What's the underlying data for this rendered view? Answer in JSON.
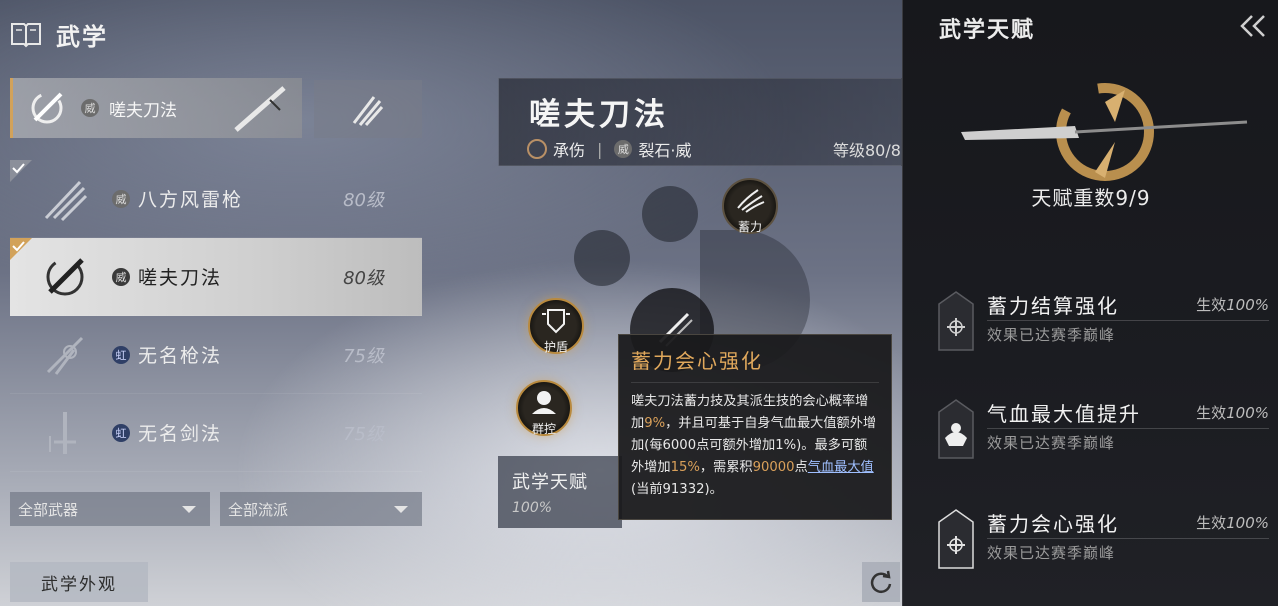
{
  "header": {
    "title": "武学"
  },
  "left": {
    "selected_card": {
      "glyph": "威",
      "name": "嗟夫刀法"
    },
    "list": [
      {
        "glyph": "威",
        "name": "八方风雷枪",
        "level": "80级",
        "checked": true,
        "active": false
      },
      {
        "glyph": "威",
        "name": "嗟夫刀法",
        "level": "80级",
        "checked": true,
        "active": true
      },
      {
        "glyph": "虹",
        "name": "无名枪法",
        "level": "75级",
        "checked": false,
        "active": false
      },
      {
        "glyph": "虹",
        "name": "无名剑法",
        "level": "75级",
        "checked": false,
        "active": false
      }
    ],
    "filters": {
      "weapon": "全部武器",
      "school": "全部流派"
    },
    "appearance_label": "武学外观"
  },
  "center": {
    "banner": {
      "name": "嗟夫刀法",
      "tag1": "承伤",
      "tag2_glyph": "威",
      "tag2": "裂石·威",
      "level": "等级80/8"
    },
    "skills": {
      "charge": "蓄力",
      "shield": "护盾",
      "crowd": "群控"
    },
    "talent_box": {
      "label": "武学天赋",
      "value": "100%"
    },
    "tooltip": {
      "title": "蓄力会心强化",
      "b1": "嗟夫刀法蓄力技及其派生技的会心概率增加",
      "b2": "9%",
      "b3": "，并且可基于自身气血最大值额外增加(每6000点可额外增加1%)。最多可额外增加",
      "b4": "15%",
      "b5": "，需累积",
      "b6": "90000",
      "b7": "点",
      "b8": "气血最大值",
      "b9": "(当前91332)。"
    }
  },
  "right": {
    "title": "武学天赋",
    "count": "天赋重数9/9",
    "talents": [
      {
        "name": "蓄力结算强化",
        "effect_prefix": "生效",
        "effect": "100%",
        "desc": "效果已达赛季巅峰"
      },
      {
        "name": "气血最大值提升",
        "effect_prefix": "生效",
        "effect": "100%",
        "desc": "效果已达赛季巅峰"
      },
      {
        "name": "蓄力会心强化",
        "effect_prefix": "生效",
        "effect": "100%",
        "desc": "效果已达赛季巅峰"
      }
    ]
  },
  "colors": {
    "accent_gold": "#d9a05a",
    "tooltip_title": "#e0a85c",
    "active_row": "#e4e4e4"
  },
  "icons": [
    "book-icon",
    "blade-icon",
    "spear-icon",
    "sword-icon",
    "shield-icon",
    "burst-icon",
    "crowd-icon",
    "back-double-chevron-icon",
    "reset-icon",
    "check-corner-icon"
  ]
}
